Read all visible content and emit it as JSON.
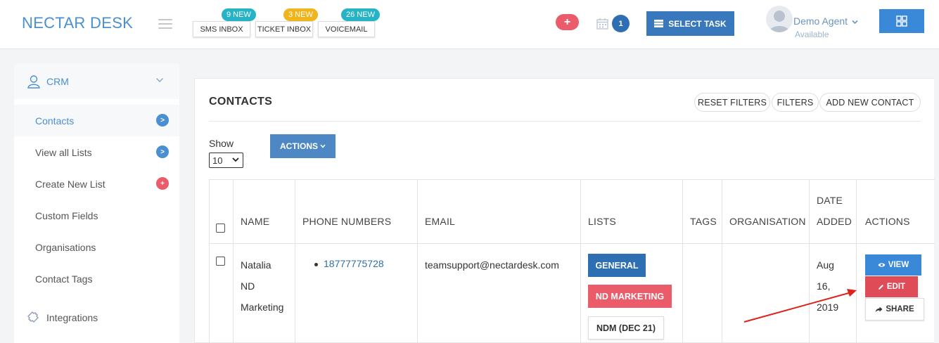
{
  "brand": {
    "name": "NECTAR DESK"
  },
  "header": {
    "inboxes": [
      {
        "label": "SMS INBOX",
        "badge": "9 NEW",
        "badge_color": "#26b3c5"
      },
      {
        "label": "TICKET INBOX",
        "badge": "3 NEW",
        "badge_color": "#f0b41c"
      },
      {
        "label": "VOICEMAIL",
        "badge": "26 NEW",
        "badge_color": "#26b3c5"
      }
    ],
    "add_symbol": "+",
    "calendar_count": "1",
    "select_task_label": "SELECT TASK",
    "agent": {
      "name": "Demo Agent",
      "status": "Available"
    }
  },
  "sidebar": {
    "section_label": "CRM",
    "items": [
      {
        "label": "Contacts",
        "active": true,
        "dot": ">",
        "dot_color": "#4a8fd0"
      },
      {
        "label": "View all Lists",
        "active": false,
        "dot": ">",
        "dot_color": "#4a8fd0"
      },
      {
        "label": "Create New List",
        "active": false,
        "dot": "+",
        "dot_color": "#ea5c6a"
      },
      {
        "label": "Custom Fields",
        "active": false
      },
      {
        "label": "Organisations",
        "active": false
      },
      {
        "label": "Contact Tags",
        "active": false
      }
    ],
    "integrations_label": "Integrations"
  },
  "contacts": {
    "title": "CONTACTS",
    "buttons": {
      "reset": "RESET FILTERS",
      "filters": "FILTERS",
      "add": "ADD NEW CONTACT"
    },
    "show_label": "Show",
    "page_size": "10",
    "actions_label": "ACTIONS",
    "columns": {
      "name": "NAME",
      "phone": "PHONE NUMBERS",
      "email": "EMAIL",
      "lists": "LISTS",
      "tags": "TAGS",
      "organisation": "ORGANISATION",
      "date_added_1": "DATE",
      "date_added_2": "ADDED",
      "actions": "ACTIONS"
    },
    "rows": [
      {
        "name_lines": [
          "Natalia",
          "ND",
          "Marketing"
        ],
        "phone": "18777775728",
        "email": "teamsupport@nectardesk.com",
        "lists": [
          "GENERAL",
          "ND MARKETING",
          "NDM (DEC 21)"
        ],
        "tags": "",
        "organisation": "",
        "date_lines": [
          "Aug",
          "16,",
          "2019"
        ],
        "actions": {
          "view": "VIEW",
          "edit": "EDIT",
          "share": "SHARE"
        }
      }
    ]
  },
  "colors": {
    "accent": "#3a78bd",
    "danger": "#ea5c6a",
    "annotation_arrow": "#e0201a"
  }
}
